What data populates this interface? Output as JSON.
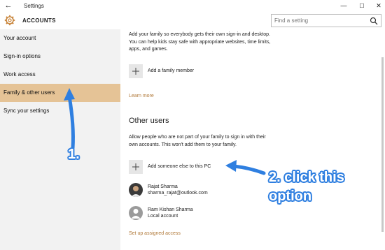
{
  "window": {
    "title": "Settings",
    "back_glyph": "←",
    "minimize_glyph": "—",
    "maximize_glyph": "☐",
    "close_glyph": "✕"
  },
  "header": {
    "section": "ACCOUNTS",
    "icon": "gear-icon",
    "search_placeholder": "Find a setting"
  },
  "sidebar": {
    "items": [
      {
        "label": "Your account",
        "active": false
      },
      {
        "label": "Sign-in options",
        "active": false
      },
      {
        "label": "Work access",
        "active": false
      },
      {
        "label": "Family & other users",
        "active": true
      },
      {
        "label": "Sync your settings",
        "active": false
      }
    ],
    "active_color": "#e5c396"
  },
  "family": {
    "description_line1": "Add your family so everybody gets their own sign-in and desktop.",
    "description_line2": "You can help kids stay safe with appropriate websites, time limits,",
    "description_line3": "apps, and games.",
    "add_label": "Add a family member",
    "learn_more": "Learn more"
  },
  "other_users": {
    "heading": "Other users",
    "description_line1": "Allow people who are not part of your family to sign in with their",
    "description_line2": "own accounts. This won't add them to your family.",
    "add_label": "Add someone else to this PC",
    "users": [
      {
        "name": "Rajat Sharma",
        "detail": "sharma_rajat@outlook.com"
      },
      {
        "name": "Ram Kishan Sharma",
        "detail": "Local account"
      }
    ],
    "assigned_access_link": "Set up assigned access"
  },
  "annotations": {
    "step1": "1.",
    "step2_line1": "2. click this",
    "step2_line2": "option",
    "color": "#2f7fe0"
  },
  "colors": {
    "accent": "#b07838",
    "sidebar_bg": "#f2f2f2"
  }
}
